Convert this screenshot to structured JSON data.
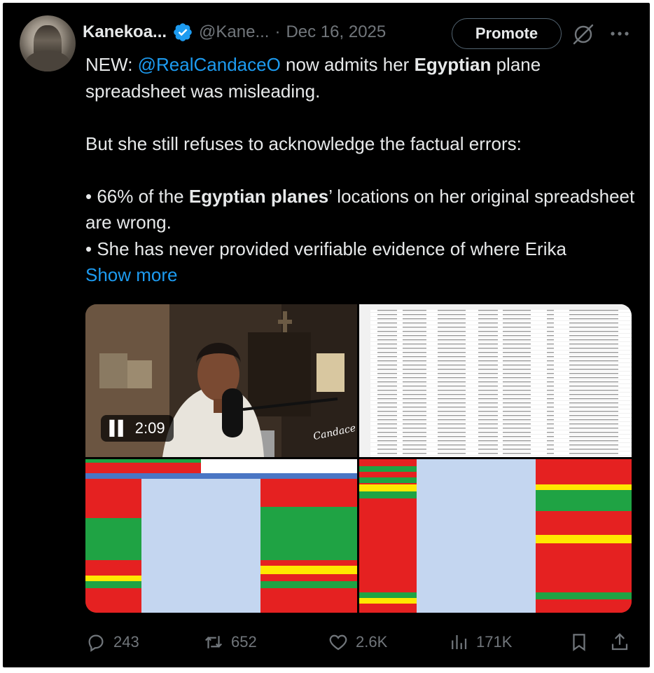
{
  "tweet": {
    "display_name": "Kanekoa...",
    "handle": "@Kane...",
    "separator": "·",
    "date": "Dec 16, 2025",
    "promote_label": "Promote",
    "line1_pre": "NEW: ",
    "mention": "@RealCandaceO",
    "line1_mid": " now admits her ",
    "line1_bold": "Egyptian",
    "line1_post": " plane spreadsheet was misleading.",
    "para2": "But she still refuses to acknowledge the factual errors:",
    "bullet1_pre": "• 66% of the ",
    "bullet1_bold": "Egyptian planes",
    "bullet1_post": "’ locations on her original spreadsheet are wrong.",
    "bullet2": "• She has never provided verifiable evidence of where Erika",
    "show_more": "Show more"
  },
  "media": {
    "video_time": "2:09",
    "signature": "Candace"
  },
  "actions": {
    "replies": "243",
    "reposts": "652",
    "likes": "2.6K",
    "views": "171K"
  },
  "colors": {
    "background": "#000000",
    "text": "#e7e9ea",
    "muted": "#71767b",
    "accent": "#1d9bf0"
  },
  "icons": [
    "verified-badge-icon",
    "grok-icon",
    "more-icon",
    "reply-icon",
    "repost-icon",
    "like-icon",
    "views-icon",
    "bookmark-icon",
    "share-icon",
    "pause-icon"
  ]
}
